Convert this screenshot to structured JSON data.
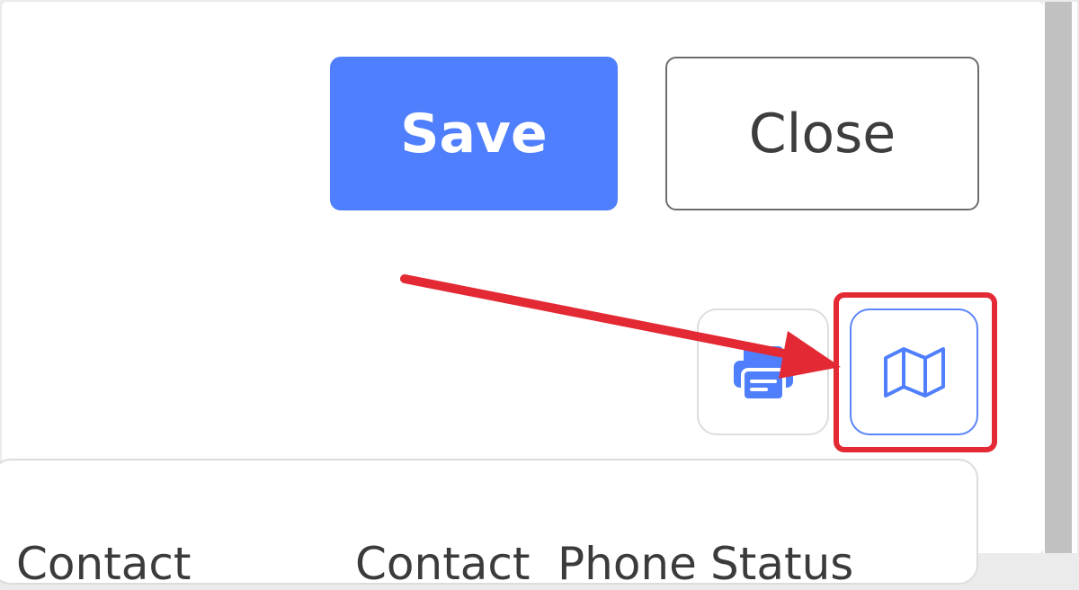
{
  "toolbar": {
    "save_label": "Save",
    "close_label": "Close"
  },
  "actions": {
    "print_icon": "printer-icon",
    "map_icon": "map-icon"
  },
  "table": {
    "columns": [
      "Contact",
      "Contact",
      "Phone",
      "Status"
    ]
  },
  "colors": {
    "primary": "#4f7ffc",
    "highlight": "#e32934"
  }
}
